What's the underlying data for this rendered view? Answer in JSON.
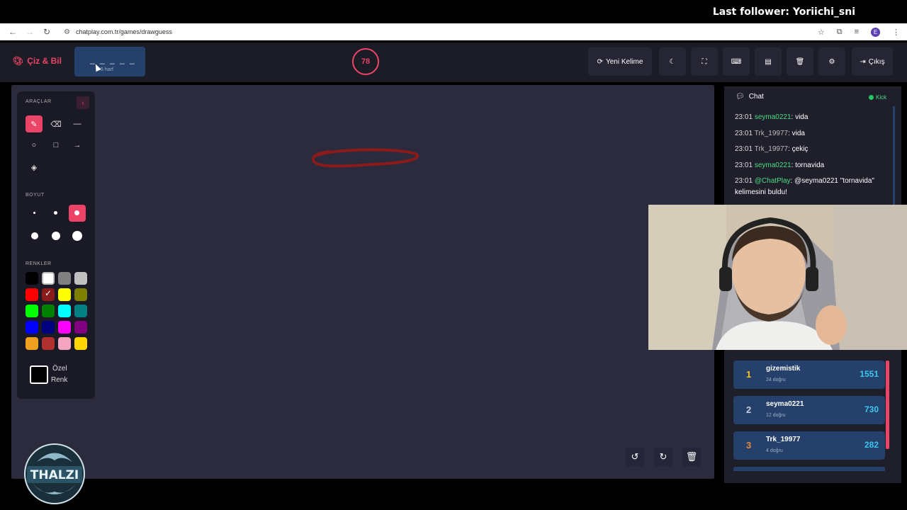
{
  "overlay": {
    "last_follower": "Last follower: Yoriichi_sni"
  },
  "browser": {
    "url": "chatplay.com.tr/games/drawguess",
    "profile_initial": "E"
  },
  "app": {
    "title": "Çiz & Bil",
    "word_mask": "_ _ _ _ _",
    "word_hint": "5 harf",
    "timer": "78",
    "new_word_label": "Yeni Kelime",
    "exit_label": "Çıkış"
  },
  "tools_panel": {
    "tools_heading": "ARAÇLAR",
    "size_heading": "BOYUT",
    "colors_heading": "RENKLER",
    "custom_color_line1": "Özel",
    "custom_color_line2": "Renk",
    "selected_tool": "pen",
    "selected_size_index": 2,
    "selected_color": "#8b1a1a",
    "colors": [
      "#000000",
      "#ffffff",
      "#808080",
      "#c0c0c0",
      "#ff0000",
      "#8b1a1a",
      "#ffff00",
      "#808000",
      "#00ff00",
      "#008000",
      "#00ffff",
      "#008080",
      "#0000ff",
      "#000080",
      "#ff00ff",
      "#800080",
      "#f0a020",
      "#b03030",
      "#f4a6c0",
      "#ffd700"
    ]
  },
  "chat": {
    "title": "Chat",
    "platform": "Kick",
    "messages": [
      {
        "time": "23:01",
        "user": "seyma0221",
        "user_color": "green",
        "text": "vida"
      },
      {
        "time": "23:01",
        "user": "Trk_19977",
        "user_color": "gray",
        "text": "vida"
      },
      {
        "time": "23:01",
        "user": "Trk_19977",
        "user_color": "gray",
        "text": "çekiç"
      },
      {
        "time": "23:01",
        "user": "seyma0221",
        "user_color": "green",
        "text": "tornavida"
      },
      {
        "time": "23:01",
        "user": "@ChatPlay",
        "user_color": "green",
        "text": "@seyma0221 \"tornavida\" kelimesini buldu!"
      }
    ]
  },
  "leaderboard": [
    {
      "rank": "1",
      "name": "gizemistik",
      "sub": "24 doğru",
      "score": "1551",
      "rank_color": "#f5c518"
    },
    {
      "rank": "2",
      "name": "seyma0221",
      "sub": "12 doğru",
      "score": "730",
      "rank_color": "#c7d0dc"
    },
    {
      "rank": "3",
      "name": "Trk_19977",
      "sub": "4 doğru",
      "score": "282",
      "rank_color": "#e08a3c"
    }
  ],
  "stream_logo": {
    "text": "THALZI"
  }
}
